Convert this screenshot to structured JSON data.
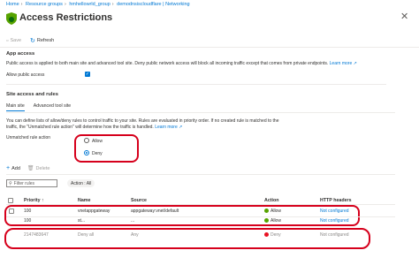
{
  "breadcrumb": [
    "Home",
    "Resource groups",
    "hmhellowrld_group",
    "demodnsiscloudflare | Networking"
  ],
  "page": {
    "title": "Access Restrictions",
    "more": "...",
    "close": "✕"
  },
  "toolbar": {
    "save_label": "Save",
    "refresh_label": "Refresh"
  },
  "app_access": {
    "heading": "App access",
    "description": "Public access is applied to both main site and advanced tool site. Deny public network access will block all incoming traffic except that comes from private endpoints.",
    "learn_more": "Learn more",
    "allow_public_label": "Allow public access",
    "allow_public_checked": true
  },
  "site_access": {
    "heading": "Site access and rules",
    "tabs": [
      "Main site",
      "Advanced tool site"
    ],
    "active_tab": 0,
    "description_line1": "You can define lists of allow/deny rules to control traffic to your site. Rules are evaluated in priority order. If no created rule is matched to the",
    "description_line2_pre": "traffic, the \"Unmatched rule action\" will determine how the traffic is handled.",
    "learn_more": "Learn more",
    "unmatched_label": "Unmatched rule action",
    "options": [
      "Allow",
      "Deny"
    ],
    "selected": "Deny"
  },
  "rules_toolbar": {
    "add_label": "Add",
    "delete_label": "Delete"
  },
  "filter": {
    "placeholder": "Filter rules",
    "pill": "Action : All"
  },
  "table": {
    "headers": [
      "Priority",
      "Name",
      "Source",
      "Action",
      "HTTP headers"
    ],
    "rows": [
      {
        "priority": "100",
        "name": "vnetappgateway",
        "source": "appgateway:vnet/default",
        "action": "Allow",
        "action_status": "allow",
        "headers": "Not configured"
      },
      {
        "priority": "100",
        "name": "st...",
        "source": "...",
        "action": "Allow",
        "action_status": "allow",
        "headers": "Not configured"
      },
      {
        "priority": "2147483647",
        "name": "Deny all",
        "source": "Any",
        "action": "Deny",
        "action_status": "deny",
        "headers": "Not configured"
      }
    ]
  },
  "colors": {
    "accent": "#0078d4",
    "highlight": "#d6001c",
    "allow": "#57a300",
    "deny": "#e81123"
  }
}
